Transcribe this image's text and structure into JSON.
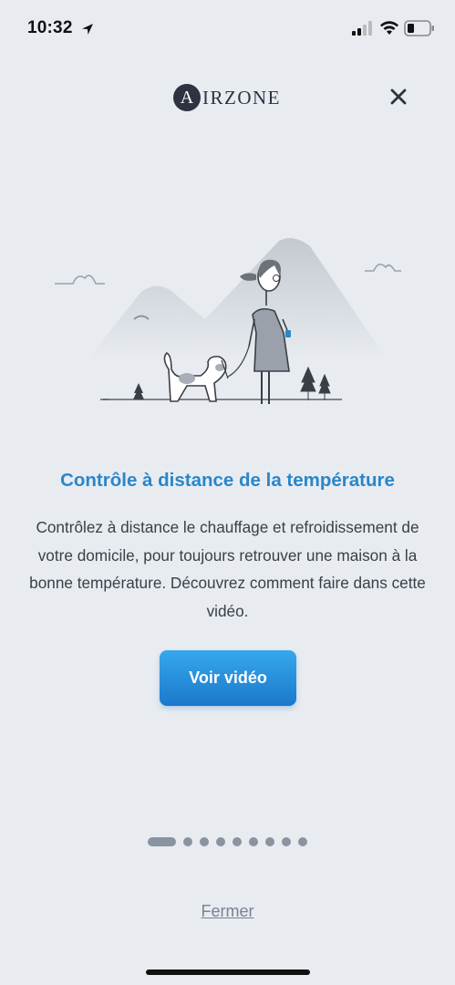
{
  "status_bar": {
    "time": "10:32"
  },
  "header": {
    "logo_letter": "A",
    "logo_text": "IRZONE"
  },
  "onboarding": {
    "title": "Contrôle à distance de la température",
    "description": "Contrôlez à distance le chauffage et refroidissement de votre domicile, pour toujours retrouver une maison à la bonne température. Découvrez comment faire dans cette vidéo.",
    "video_button": "Voir vidéo",
    "page_total": 9,
    "page_current": 1
  },
  "footer": {
    "close_link": "Fermer"
  },
  "colors": {
    "accent": "#2a86c9",
    "button_top": "#36a8ec",
    "button_bottom": "#1b78cc",
    "background": "#e8ecf1"
  }
}
